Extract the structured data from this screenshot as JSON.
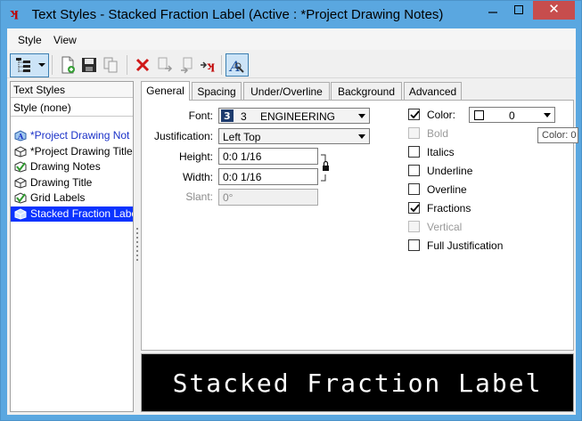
{
  "window": {
    "title": "Text Styles - Stacked Fraction Label (Active : *Project Drawing Notes)",
    "close_label": "✕"
  },
  "menu": {
    "style": "Style",
    "view": "View"
  },
  "left_pane": {
    "header": "Text Styles",
    "none_item": "Style (none)",
    "items": [
      {
        "label": "*Project Drawing Not",
        "icon": "active-style-icon",
        "state": "modified"
      },
      {
        "label": "*Project Drawing Title",
        "icon": "style-icon",
        "state": "modified-normal"
      },
      {
        "label": "Drawing Notes",
        "icon": "library-style-icon",
        "state": "normal"
      },
      {
        "label": "Drawing Title",
        "icon": "style-icon",
        "state": "normal"
      },
      {
        "label": "Grid Labels",
        "icon": "library-style-icon",
        "state": "normal"
      },
      {
        "label": "Stacked Fraction Labe",
        "icon": "style-icon",
        "state": "selected"
      }
    ]
  },
  "tabs": [
    "General",
    "Spacing",
    "Under/Overline",
    "Background",
    "Advanced"
  ],
  "general": {
    "font_label": "Font:",
    "font_number": "3",
    "font_name": "ENGINEERING",
    "justification_label": "Justification:",
    "justification_value": "Left Top",
    "height_label": "Height:",
    "height_value": "0:0 1/16",
    "width_label": "Width:",
    "width_value": "0:0 1/16",
    "slant_label": "Slant:",
    "slant_value": "0°",
    "color_label": "Color:",
    "color_value": "0",
    "color_tooltip": "Color: 0",
    "checks": [
      {
        "label": "Color:",
        "checked": true,
        "enabled": true
      },
      {
        "label": "Bold",
        "checked": false,
        "enabled": false
      },
      {
        "label": "Italics",
        "checked": false,
        "enabled": true
      },
      {
        "label": "Underline",
        "checked": false,
        "enabled": true
      },
      {
        "label": "Overline",
        "checked": false,
        "enabled": true
      },
      {
        "label": "Fractions",
        "checked": true,
        "enabled": true
      },
      {
        "label": "Vertical",
        "checked": false,
        "enabled": false
      },
      {
        "label": "Full Justification",
        "checked": false,
        "enabled": true
      }
    ]
  },
  "preview": {
    "text": "Stacked Fraction Label"
  },
  "colors": {
    "title_bg": "#5aa7e0",
    "close_bg": "#c74d4d",
    "selection": "#0a33ff",
    "modified_text": "#1a31c8"
  }
}
